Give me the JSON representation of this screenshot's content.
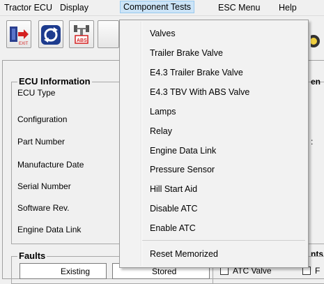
{
  "menubar": {
    "items": [
      "Tractor ECU",
      "Display",
      "Component Tests",
      "ESC Menu",
      "Help"
    ]
  },
  "toolbar": {
    "exit_icon_text": "EXIT",
    "abs_icon_text": "ABS"
  },
  "ecu_info": {
    "legend": "ECU Information",
    "labels": [
      "ECU Type",
      "Configuration",
      "Part Number",
      "Manufacture Date",
      "Serial Number",
      "Software Rev.",
      "Engine Data Link"
    ]
  },
  "right_clipped": {
    "top_label": "en",
    "colon": ":",
    "bottom_label": "nts"
  },
  "faults": {
    "legend": "Faults",
    "existing_label": "Existing",
    "stored_label": "Stored"
  },
  "atc": {
    "atc_valve_label": "ATC Valve",
    "clipped_label": "F"
  },
  "component_tests_menu": {
    "items": [
      "Valves",
      "Trailer Brake Valve",
      "E4.3 Trailer Brake Valve",
      "E4.3 TBV With ABS Valve",
      "Lamps",
      "Relay",
      "Engine Data Link",
      "Pressure Sensor",
      "Hill Start Aid",
      "Disable ATC",
      "Enable ATC"
    ],
    "reset_item": "Reset Memorized"
  },
  "colors": {
    "menu_highlight": "#cce4f7",
    "menu_highlight_border": "#99c9ef",
    "window_bg": "#f0f0f0"
  }
}
